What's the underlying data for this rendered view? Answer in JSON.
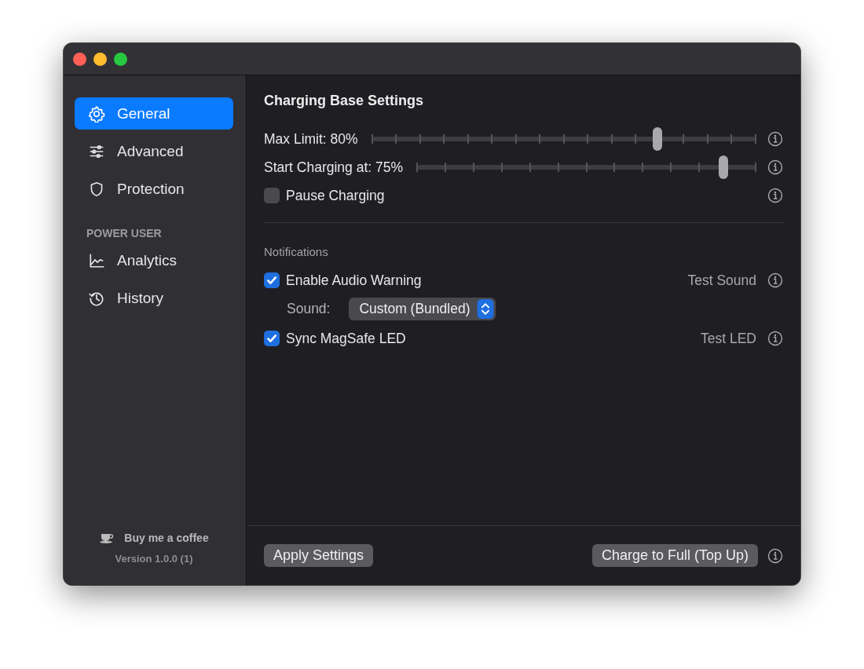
{
  "sidebar": {
    "items": [
      {
        "label": "General",
        "selected": true
      },
      {
        "label": "Advanced",
        "selected": false
      },
      {
        "label": "Protection",
        "selected": false
      }
    ],
    "section": {
      "title": "POWER USER",
      "items": [
        {
          "label": "Analytics",
          "selected": false
        },
        {
          "label": "History",
          "selected": false
        }
      ]
    },
    "footer": {
      "coffee_link": "Buy me a coffee",
      "version": "Version 1.0.0 (1)"
    }
  },
  "main": {
    "title": "Charging Base Settings",
    "controls": [
      {
        "kind": "slider",
        "label": "Max Limit: 80%",
        "level": 0.745
      },
      {
        "kind": "slider",
        "label": "Start Charging at: 75%",
        "level": 0.905
      },
      {
        "kind": "checkbox",
        "label": "Pause Charging",
        "checked": false
      }
    ],
    "notifications": {
      "title": "Notifications",
      "rows": [
        {
          "label": "Enable Audio Warning",
          "checked": true,
          "action": "Test Sound",
          "sound": {
            "label": "Sound:",
            "value": "Custom (Bundled)"
          }
        },
        {
          "label": "Sync MagSafe LED",
          "checked": true,
          "action": "Test LED"
        }
      ]
    }
  },
  "buttons": {
    "apply": "Apply Settings",
    "charge": "Charge to Full (Top Up)"
  }
}
